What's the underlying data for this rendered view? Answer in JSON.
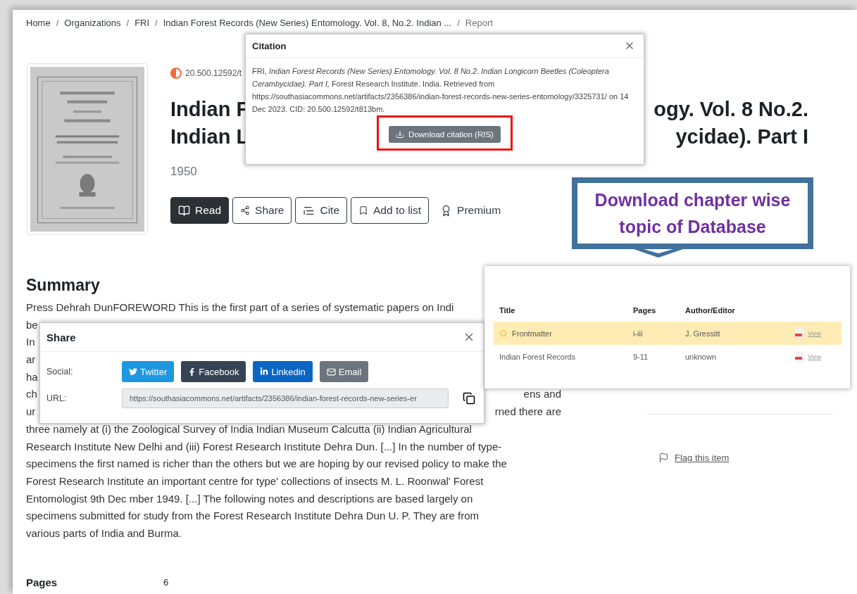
{
  "breadcrumb": {
    "separator": "/",
    "items": [
      {
        "label": "Home",
        "current": false
      },
      {
        "label": "Organizations",
        "current": false
      },
      {
        "label": "FRI",
        "current": false
      },
      {
        "label": "Indian Forest Records (New Series) Entomology. Vol. 8, No.2. Indian ...",
        "current": false
      },
      {
        "label": "Report",
        "current": true
      }
    ]
  },
  "item": {
    "doi": "20.500.12592/t",
    "title_lines": [
      {
        "left": "Indian F",
        "right": "ogy. Vol. 8 No.2."
      },
      {
        "left": "Indian L",
        "right": "ycidae). Part I"
      }
    ],
    "year": "1950",
    "actions": [
      {
        "kind": "primary",
        "label": "Read"
      },
      {
        "kind": "outline",
        "label": "Share"
      },
      {
        "kind": "outline",
        "label": "Cite"
      },
      {
        "kind": "outline",
        "label": "Add to list"
      },
      {
        "kind": "plain",
        "label": "Premium"
      }
    ]
  },
  "summary": {
    "heading": "Summary",
    "lines": [
      {
        "left": "Press Dehrah DunFOREWORD This is the first part of a series of systematic papers on Indi"
      },
      {
        "left": "be"
      },
      {
        "left": "In"
      },
      {
        "left": "ar"
      },
      {
        "left": "ha"
      },
      {
        "left": "ch",
        "right": "ens and"
      },
      {
        "left": "ur",
        "right": "rned there are"
      },
      {
        "left": "three namely at (i) the Zoological Survey of India Indian Museum Calcutta (ii) Indian Agricultural"
      },
      {
        "left": "Research Institute New Delhi and (iii) Forest Research Institute Dehra Dun. [...] In the number of type-"
      },
      {
        "left": "specimens the first named is richer than the others but we are hoping by our revised policy to make the"
      },
      {
        "left": "Forest Research Institute an important centre for type' collections of insects M. L. Roonwal' Forest"
      },
      {
        "left": "Entomologist 9th Dec mber 1949. [...] The following notes and descriptions are based largely on"
      },
      {
        "left": "specimens submitted for study from the Forest Research Institute Dehra Dun U. P. They are from"
      },
      {
        "left": "various parts of India and Burma."
      }
    ]
  },
  "details": [
    {
      "label": "Pages",
      "value": "6"
    }
  ],
  "sidebar": {
    "flag": "Flag this item"
  },
  "citation_dialog": {
    "title": "Citation",
    "text": "FRI, *Indian Forest Records (New Series) Entomology. Vol. 8 No.2. Indian Longicorn Beetles (Coleoptera Cerambycidae). Part I,* Forest Research Institute. India. Retrieved from https://southasiacommons.net/artifacts/2356386/indian-forest-records-new-series-entomology/3325731/ on 14 Dec 2023. CID: 20.500.12592/t813bm.",
    "button": {
      "label": "Download citation (RIS)",
      "highlighted": true
    }
  },
  "share_dialog": {
    "title": "Share",
    "social_label": "Social:",
    "buttons": [
      {
        "label": "Twitter",
        "color": "#1d97e0"
      },
      {
        "label": "Facebook",
        "color": "#354354"
      },
      {
        "label": "Linkedin",
        "color": "#0a66c2"
      },
      {
        "label": "Email",
        "color": "#6c757d"
      }
    ],
    "url_label": "URL:",
    "url": "https://southasiacommons.net/artifacts/2356386/indian-forest-records-new-series-er"
  },
  "callout": {
    "text": "Download chapter wise\ntopic of Database"
  },
  "chapters": {
    "columns": [
      "Title",
      "Pages",
      "Author/Editor"
    ],
    "rows": [
      {
        "title": "Frontmatter",
        "pages": "i-iii",
        "author": "J. Gressitt",
        "action": "View",
        "selected": true
      },
      {
        "title": "Indian Forest Records",
        "pages": "9-11",
        "author": "unknown",
        "action": "View",
        "selected": false
      }
    ]
  }
}
